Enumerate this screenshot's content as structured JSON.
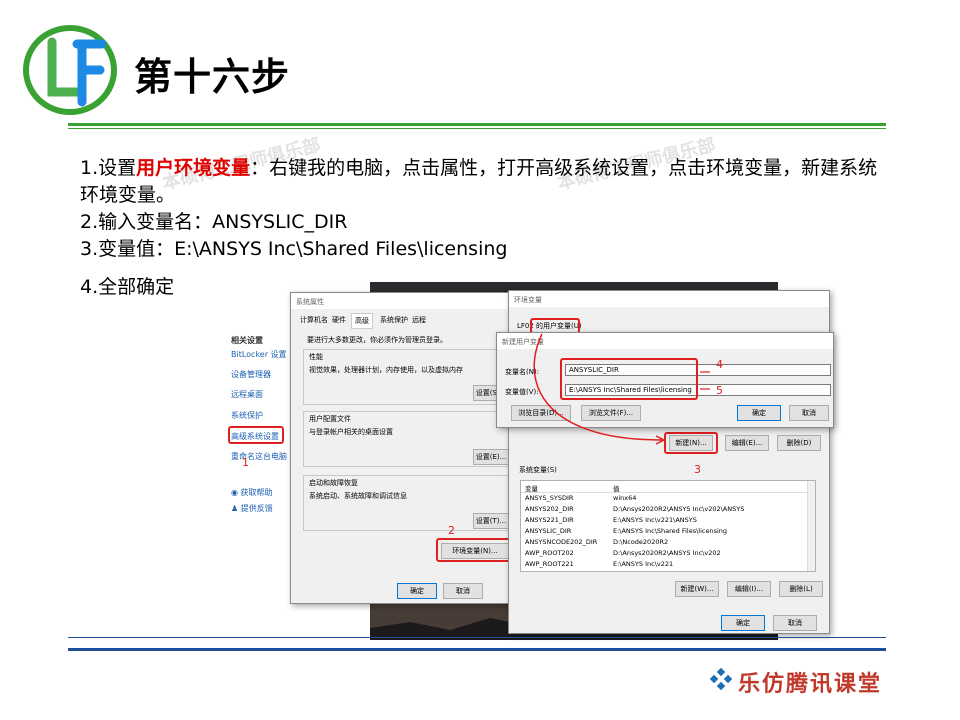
{
  "header": {
    "title": "第十六步",
    "logo_text": "LF"
  },
  "steps": {
    "s1_prefix": "1.设置",
    "s1_highlight": "用户环境变量",
    "s1_rest": "：右键我的电脑，点击属性，打开高级系统设置，点击环境变量，新建系统 环境变量。",
    "s2": "2.输入变量名：ANSYSLIC_DIR",
    "s3": "3.变量值：E:\\ANSYS Inc\\Shared Files\\licensing",
    "s4": "4.全部确定"
  },
  "watermark": {
    "text1": "本硕博工程师俱乐部",
    "text2": "本硕博工程师俱乐部"
  },
  "related": {
    "heading": "相关设置",
    "bitlocker": "BitLocker 设置",
    "device_manager": "设备管理器",
    "remote_desktop": "远程桌面",
    "system_protection": "系统保护",
    "advanced": "高级系统设置",
    "rename": "重命名这台电脑",
    "help": "获取帮助",
    "feedback": "提供反馈"
  },
  "sysprops": {
    "title": "系统属性",
    "tabs": [
      "计算机名",
      "硬件",
      "高级",
      "系统保护",
      "远程"
    ],
    "intro": "要进行大多数更改，你必须作为管理员登录。",
    "perf_title": "性能",
    "perf_desc": "视觉效果，处理器计划，内存使用，以及虚拟内存",
    "perf_btn": "设置(S)...",
    "profile_title": "用户配置文件",
    "profile_desc": "与登录帐户相关的桌面设置",
    "profile_btn": "设置(E)...",
    "startup_title": "启动和故障恢复",
    "startup_desc": "系统启动、系统故障和调试信息",
    "startup_btn": "设置(T)...",
    "env_btn": "环境变量(N)...",
    "ok": "确定",
    "cancel": "取消"
  },
  "envvars": {
    "title": "环境变量",
    "user_label": "LF02 的用户变量(U)",
    "new_btn": "新建(N)...",
    "edit_btn": "编辑(E)...",
    "delete_btn": "删除(D)",
    "sys_label": "系统变量(S)",
    "col_var": "变量",
    "col_val": "值",
    "rows": [
      [
        "ANSYS_SYSDIR",
        "winx64"
      ],
      [
        "ANSYS202_DIR",
        "D:\\Ansys2020R2\\ANSYS Inc\\v202\\ANSYS"
      ],
      [
        "ANSYS221_DIR",
        "E:\\ANSYS Inc\\v221\\ANSYS"
      ],
      [
        "ANSYSLIC_DIR",
        "E:\\ANSYS Inc\\Shared Files\\licensing"
      ],
      [
        "ANSYSNCODE202_DIR",
        "D:\\Ncode2020R2"
      ],
      [
        "AWP_ROOT202",
        "D:\\Ansys2020R2\\ANSYS Inc\\v202"
      ],
      [
        "AWP_ROOT221",
        "E:\\ANSYS Inc\\v221"
      ]
    ],
    "sys_new": "新建(W)...",
    "sys_edit": "编辑(I)...",
    "sys_delete": "删除(L)",
    "ok": "确定",
    "cancel": "取消"
  },
  "newvar": {
    "title": "新建用户变量",
    "name_label": "变量名(N):",
    "name_value": "ANSYSLIC_DIR",
    "value_label": "变量值(V):",
    "value_value": "E:\\ANSYS Inc\\Shared Files\\licensing",
    "browse_dir": "浏览目录(D)...",
    "browse_file": "浏览文件(F)...",
    "ok": "确定",
    "cancel": "取消"
  },
  "annotations": {
    "n1": "1",
    "n2": "2",
    "n3": "3",
    "n4": "4",
    "n5": "5"
  },
  "footer": {
    "brand": "乐仿腾讯课堂"
  },
  "colors": {
    "green_rule": "#3aa233",
    "blue_rule": "#1f4e9a",
    "highlight": "#e00000",
    "brand": "#c0392b"
  }
}
